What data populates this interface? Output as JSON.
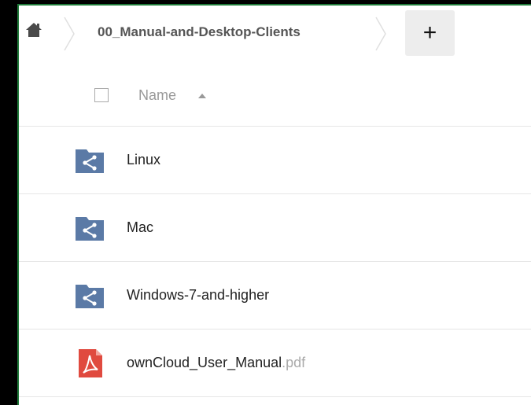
{
  "breadcrumb": {
    "current": "00_Manual-and-Desktop-Clients",
    "new_button_label": "+"
  },
  "list_header": {
    "name_label": "Name",
    "sort": "ascending"
  },
  "files": [
    {
      "name": "Linux",
      "ext": "",
      "type": "shared-folder",
      "icon": "shared-folder-icon"
    },
    {
      "name": "Mac",
      "ext": "",
      "type": "shared-folder",
      "icon": "shared-folder-icon"
    },
    {
      "name": "Windows-7-and-higher",
      "ext": "",
      "type": "shared-folder",
      "icon": "shared-folder-icon"
    },
    {
      "name": "ownCloud_User_Manual",
      "ext": ".pdf",
      "type": "pdf",
      "icon": "pdf-icon"
    }
  ],
  "colors": {
    "folder": "#5b7aa6",
    "pdf": "#e04a3f",
    "accent_border": "#1f7a3a"
  }
}
